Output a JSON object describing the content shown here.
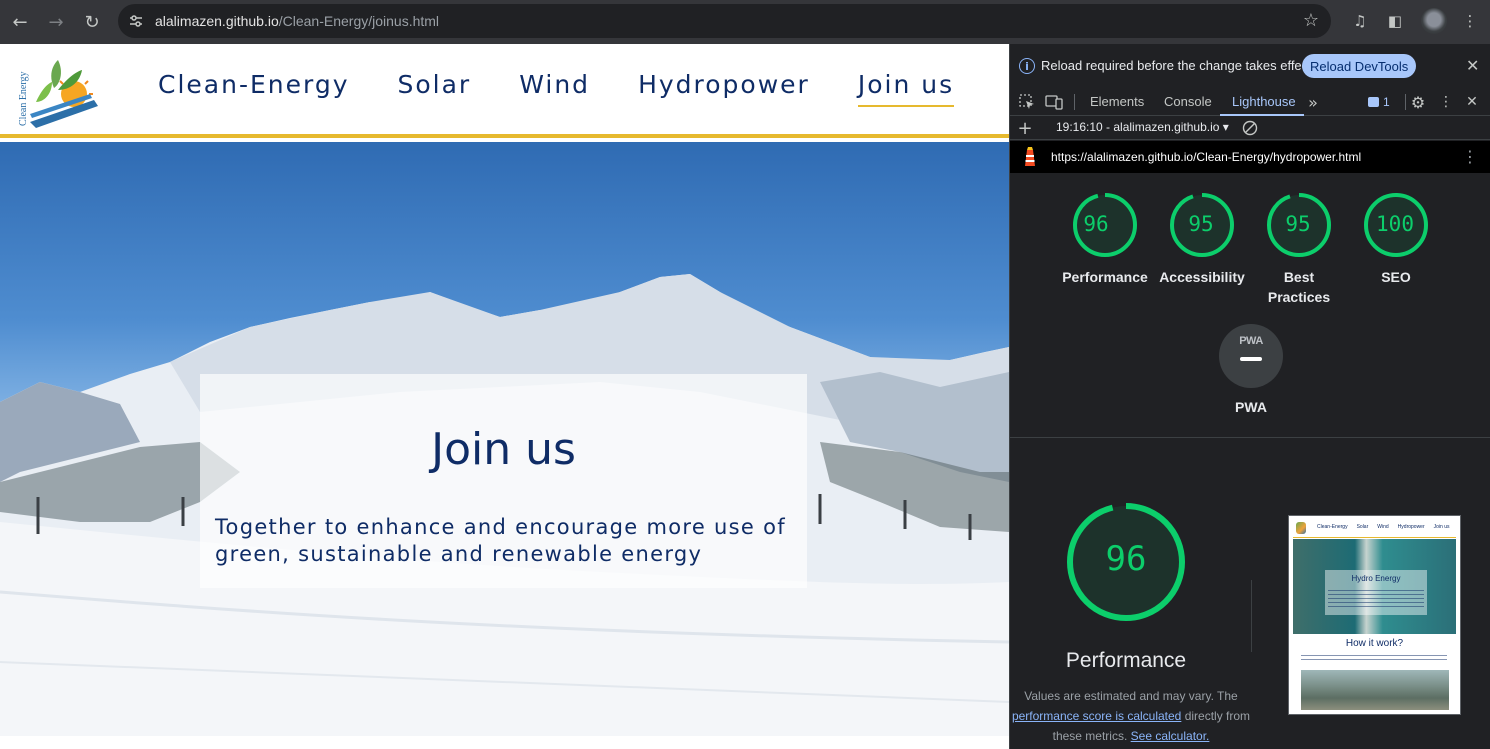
{
  "browser": {
    "url_host": "alalimazen.github.io",
    "url_path": "/Clean-Energy/joinus.html"
  },
  "site": {
    "logo_text": "Clean Energy",
    "nav": [
      {
        "label": "Clean-Energy"
      },
      {
        "label": "Solar"
      },
      {
        "label": "Wind"
      },
      {
        "label": "Hydropower"
      },
      {
        "label": "Join us",
        "active": true
      }
    ],
    "hero": {
      "title": "Join us",
      "text": "Together to enhance and encourage more use of green, sustainable and renewable energy"
    },
    "colors": {
      "navy": "#0f2c66",
      "accent": "#e6b92e"
    }
  },
  "devtools": {
    "infobar": {
      "message": "Reload required before the change takes effect.",
      "button": "Reload DevTools"
    },
    "tabs": [
      {
        "label": "Elements"
      },
      {
        "label": "Console"
      },
      {
        "label": "Lighthouse",
        "active": true
      }
    ],
    "issues_count": "1",
    "report_select": "19:16:10 - alalimazen.github.io",
    "report_url": "https://alalimazen.github.io/Clean-Energy/hydropower.html",
    "scores": [
      {
        "value": 96,
        "label": "Performance"
      },
      {
        "value": 95,
        "label": "Accessibility"
      },
      {
        "value": 95,
        "label": "Best Practices"
      },
      {
        "value": 100,
        "label": "SEO"
      }
    ],
    "pwa": {
      "badge": "PWA",
      "label": "PWA"
    },
    "performance": {
      "score": 96,
      "label": "Performance",
      "note_pre": "Values are estimated and may vary. The",
      "note_link": "performance score is calculated",
      "note_mid": "directly from these metrics.",
      "note_link2": "See calculator."
    },
    "thumbnail": {
      "nav": [
        "Clean-Energy",
        "Solar",
        "Wind",
        "Hydropower",
        "Join us"
      ],
      "hero_title": "Hydro Energy",
      "subheading": "How it work?"
    },
    "colors": {
      "pass": "#0cce6b",
      "link": "#8ab4f8"
    }
  }
}
